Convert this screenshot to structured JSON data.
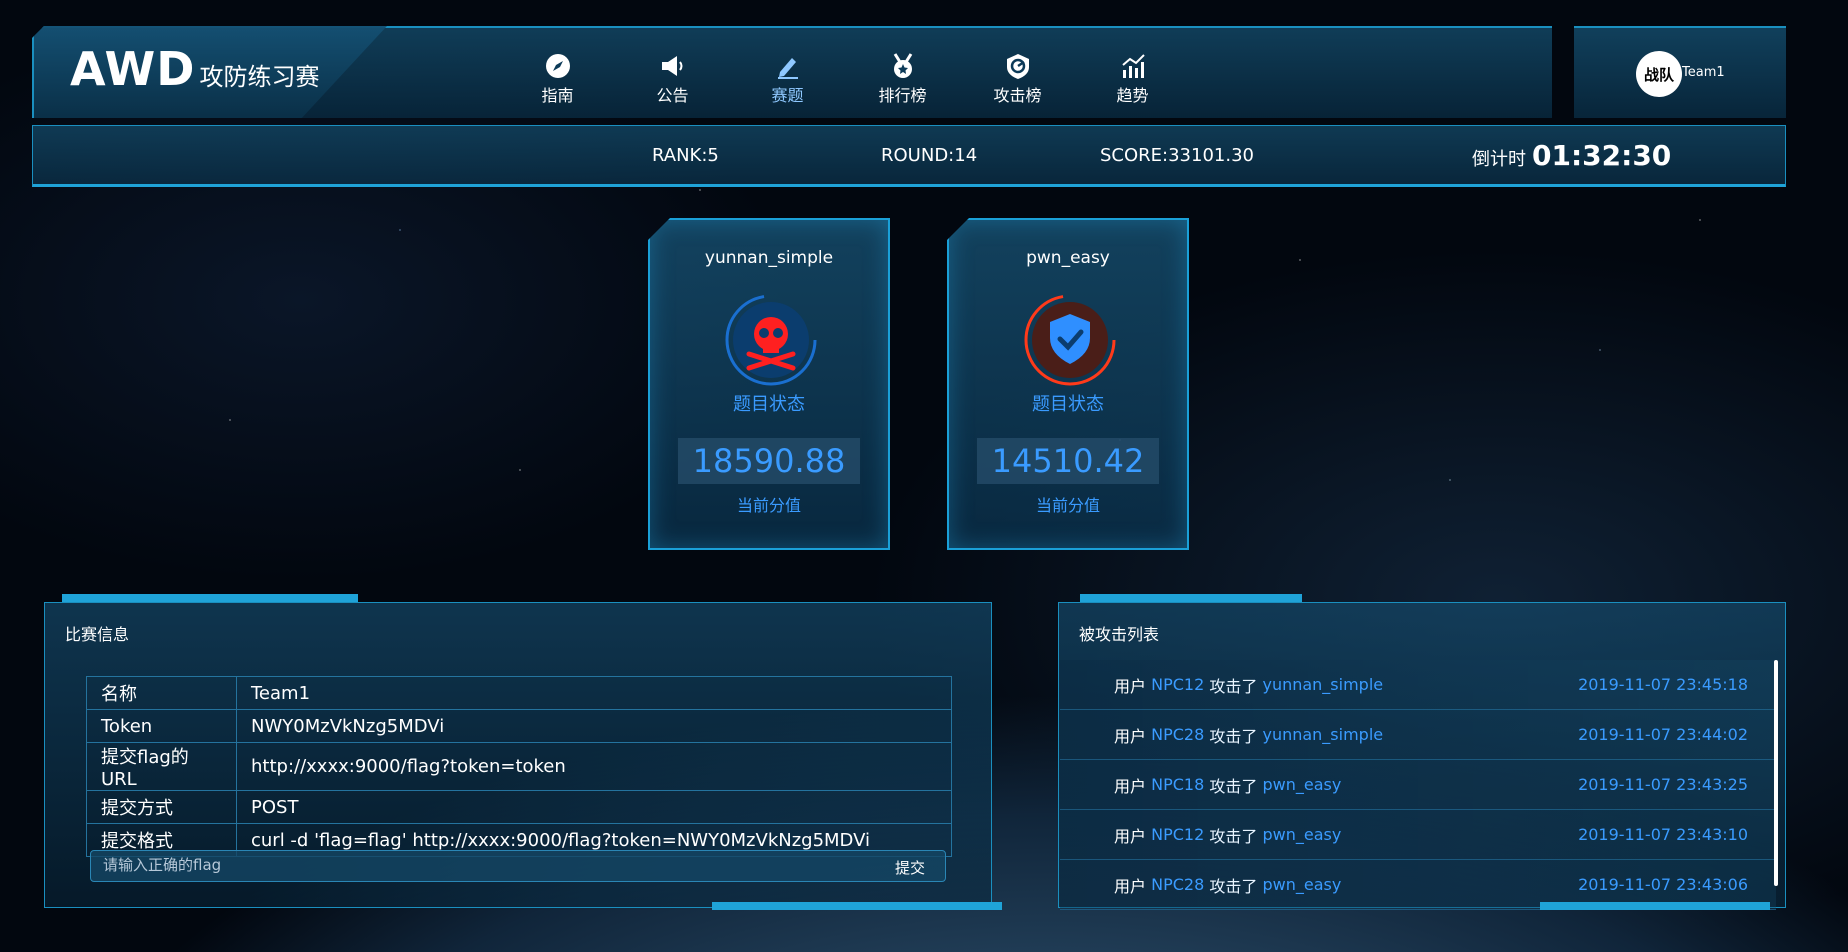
{
  "header": {
    "logo_big": "AWD",
    "logo_small": "攻防练习赛",
    "nav": [
      {
        "label": "指南",
        "icon": "compass-icon"
      },
      {
        "label": "公告",
        "icon": "megaphone-icon"
      },
      {
        "label": "赛题",
        "icon": "pencil-icon"
      },
      {
        "label": "排行榜",
        "icon": "medal-icon"
      },
      {
        "label": "攻击榜",
        "icon": "target-icon"
      },
      {
        "label": "趋势",
        "icon": "chart-icon"
      }
    ],
    "team_badge": "战队",
    "team_name": "Team1"
  },
  "status": {
    "rank": "RANK:5",
    "round": "ROUND:14",
    "score": "SCORE:33101.30",
    "countdown_label": "倒计时",
    "countdown_value": "01:32:30"
  },
  "challenges": [
    {
      "name": "yunnan_simple",
      "state_label": "题目状态",
      "icon": "skull-icon",
      "score": "18590.88",
      "score_label": "当前分值"
    },
    {
      "name": "pwn_easy",
      "state_label": "题目状态",
      "icon": "shield-check-icon",
      "score": "14510.42",
      "score_label": "当前分值"
    }
  ],
  "info_panel": {
    "title": "比赛信息",
    "rows": [
      {
        "key": "名称",
        "value": "Team1"
      },
      {
        "key": "Token",
        "value": "NWY0MzVkNzg5MDVi"
      },
      {
        "key": "提交flag的URL",
        "value": "http://xxxx:9000/flag?token=token"
      },
      {
        "key": "提交方式",
        "value": "POST"
      },
      {
        "key": "提交格式",
        "value": "curl -d 'flag=flag' http://xxxx:9000/flag?token=NWY0MzVkNzg5MDVi"
      }
    ],
    "flag_placeholder": "请输入正确的flag",
    "submit_label": "提交"
  },
  "attack_panel": {
    "title": "被攻击列表",
    "rows": [
      {
        "user": "用户",
        "attacker": "NPC12",
        "verb": "攻击了",
        "target": "yunnan_simple",
        "time": "2019-11-07 23:45:18"
      },
      {
        "user": "用户",
        "attacker": "NPC28",
        "verb": "攻击了",
        "target": "yunnan_simple",
        "time": "2019-11-07 23:44:02"
      },
      {
        "user": "用户",
        "attacker": "NPC18",
        "verb": "攻击了",
        "target": "pwn_easy",
        "time": "2019-11-07 23:43:25"
      },
      {
        "user": "用户",
        "attacker": "NPC12",
        "verb": "攻击了",
        "target": "pwn_easy",
        "time": "2019-11-07 23:43:10"
      },
      {
        "user": "用户",
        "attacker": "NPC28",
        "verb": "攻击了",
        "target": "pwn_easy",
        "time": "2019-11-07 23:43:06"
      }
    ]
  },
  "colors": {
    "accent": "#1fa3d8",
    "highlight": "#3a9bff",
    "danger": "#ff2a2a"
  }
}
